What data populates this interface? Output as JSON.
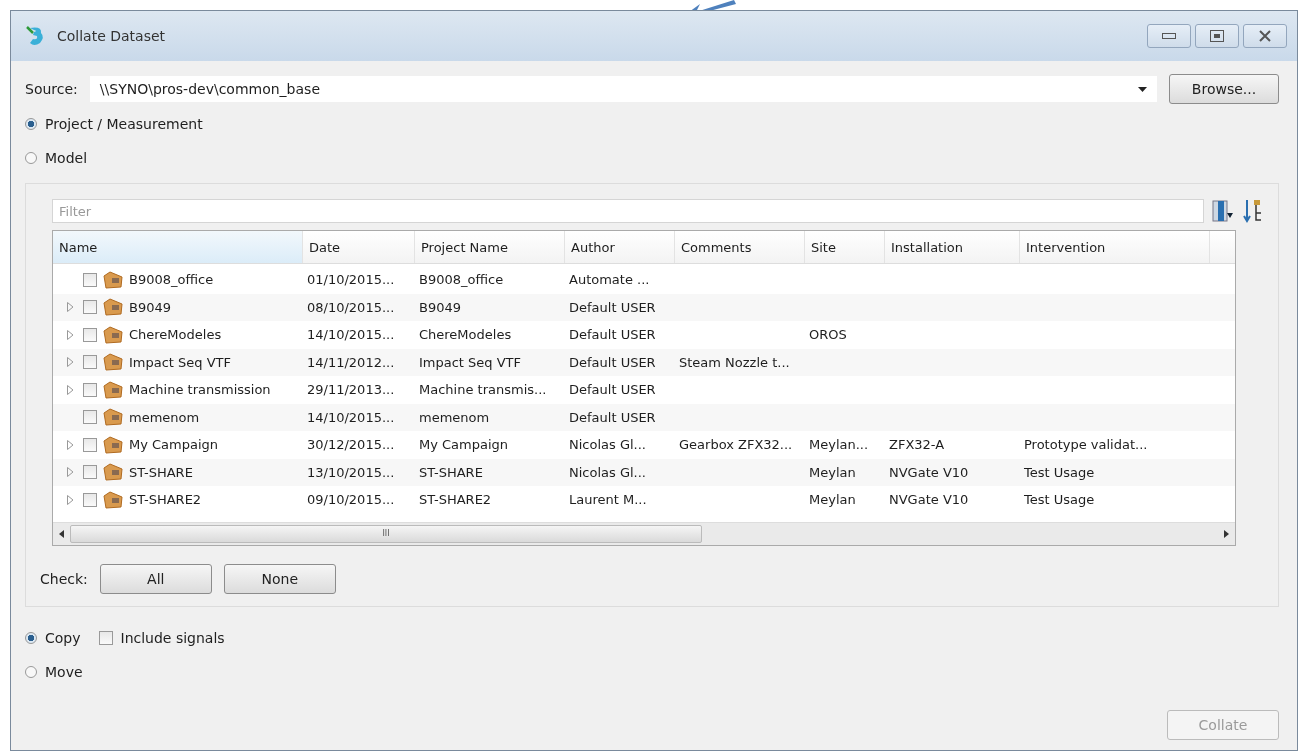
{
  "window": {
    "title": "Collate Dataset"
  },
  "source": {
    "label": "Source:",
    "value": "\\\\SYNO\\pros-dev\\common_base",
    "browse": "Browse..."
  },
  "type_options": [
    {
      "label": "Project / Measurement",
      "selected": true
    },
    {
      "label": "Model",
      "selected": false
    }
  ],
  "filter": {
    "placeholder": "Filter"
  },
  "table": {
    "columns": [
      "Name",
      "Date",
      "Project Name",
      "Author",
      "Comments",
      "Site",
      "Installation",
      "Intervention"
    ],
    "rows": [
      {
        "expandable": false,
        "checked": false,
        "cells": [
          "B9008_office",
          "01/10/2015...",
          "B9008_office",
          "Automate ...",
          "",
          "",
          "",
          ""
        ]
      },
      {
        "expandable": true,
        "checked": false,
        "cells": [
          "B9049",
          "08/10/2015...",
          "B9049",
          "Default USER",
          "",
          "",
          "",
          ""
        ]
      },
      {
        "expandable": true,
        "checked": false,
        "cells": [
          "ChereModeles",
          "14/10/2015...",
          "ChereModeles",
          "Default USER",
          "",
          "OROS",
          "",
          ""
        ]
      },
      {
        "expandable": true,
        "checked": false,
        "cells": [
          "Impact Seq VTF",
          "14/11/2012...",
          "Impact Seq VTF",
          "Default USER",
          "Steam Nozzle t...",
          "",
          "",
          ""
        ]
      },
      {
        "expandable": true,
        "checked": false,
        "cells": [
          "Machine transmission",
          "29/11/2013...",
          "Machine transmis...",
          "Default USER",
          "",
          "",
          "",
          ""
        ]
      },
      {
        "expandable": false,
        "checked": false,
        "cells": [
          "memenom",
          "14/10/2015...",
          "memenom",
          "Default USER",
          "",
          "",
          "",
          ""
        ]
      },
      {
        "expandable": true,
        "checked": false,
        "cells": [
          "My Campaign",
          "30/12/2015...",
          "My Campaign",
          "Nicolas Gl...",
          "Gearbox ZFX32...",
          "Meylan...",
          "ZFX32-A",
          "Prototype validat..."
        ]
      },
      {
        "expandable": true,
        "checked": false,
        "cells": [
          "ST-SHARE",
          "13/10/2015...",
          "ST-SHARE",
          "Nicolas Gl...",
          "",
          "Meylan",
          "NVGate V10",
          "Test Usage"
        ]
      },
      {
        "expandable": true,
        "checked": false,
        "cells": [
          "ST-SHARE2",
          "09/10/2015...",
          "ST-SHARE2",
          "Laurent M...",
          "",
          "Meylan",
          "NVGate V10",
          "Test Usage"
        ]
      }
    ],
    "scrollbar_grip": "III"
  },
  "check": {
    "label": "Check:",
    "buttons": [
      "All",
      "None"
    ]
  },
  "action_options": [
    {
      "label": "Copy",
      "selected": true
    },
    {
      "label": "Move",
      "selected": false
    }
  ],
  "include_signals": {
    "label": "Include signals",
    "checked": false
  },
  "collate": {
    "label": "Collate",
    "disabled": true
  }
}
